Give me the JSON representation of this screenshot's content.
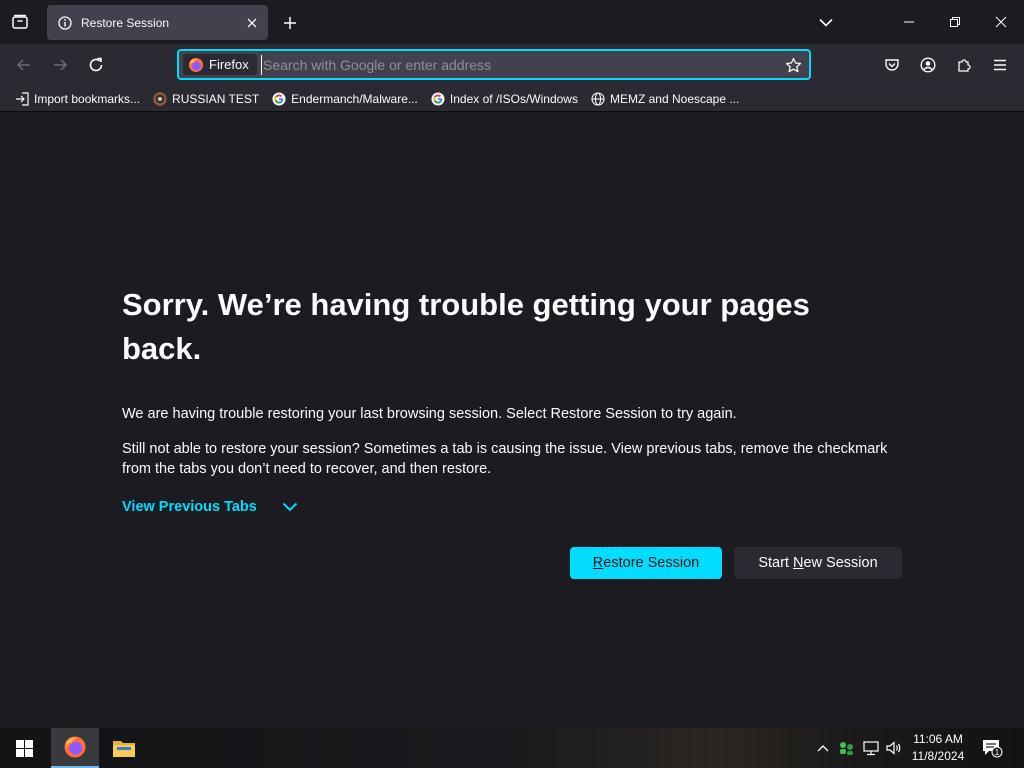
{
  "browser": {
    "tab": {
      "title": "Restore Session"
    },
    "urlbar": {
      "identity_label": "Firefox",
      "placeholder": "Search with Google or enter address",
      "value": ""
    },
    "bookmarks": [
      {
        "label": "Import bookmarks...",
        "icon": "import-icon"
      },
      {
        "label": "RUSSIAN TEST",
        "icon": "site-favicon"
      },
      {
        "label": "Endermanch/Malware...",
        "icon": "google-icon"
      },
      {
        "label": "Index of /ISOs/Windows",
        "icon": "google-icon"
      },
      {
        "label": "MEMZ and Noescape ...",
        "icon": "globe-icon"
      }
    ]
  },
  "page": {
    "heading": "Sorry. We’re having trouble getting your pages back.",
    "para1": "We are having trouble restoring your last browsing session. Select Restore Session to try again.",
    "para2": "Still not able to restore your session? Sometimes a tab is causing the issue. View previous tabs, remove the checkmark from the tabs you don’t need to recover, and then restore.",
    "view_previous": "View Previous Tabs",
    "restore_btn": {
      "pre": "",
      "accel": "R",
      "post": "estore Session"
    },
    "new_btn": {
      "pre": "Start ",
      "accel": "N",
      "post": "ew Session"
    }
  },
  "taskbar": {
    "time": "11:06 AM",
    "date": "11/8/2024",
    "notification_count": "1"
  },
  "colors": {
    "accent": "#00ddff",
    "background": "#1c1b22",
    "toolbar": "#2b2a33",
    "field": "#42414d"
  }
}
